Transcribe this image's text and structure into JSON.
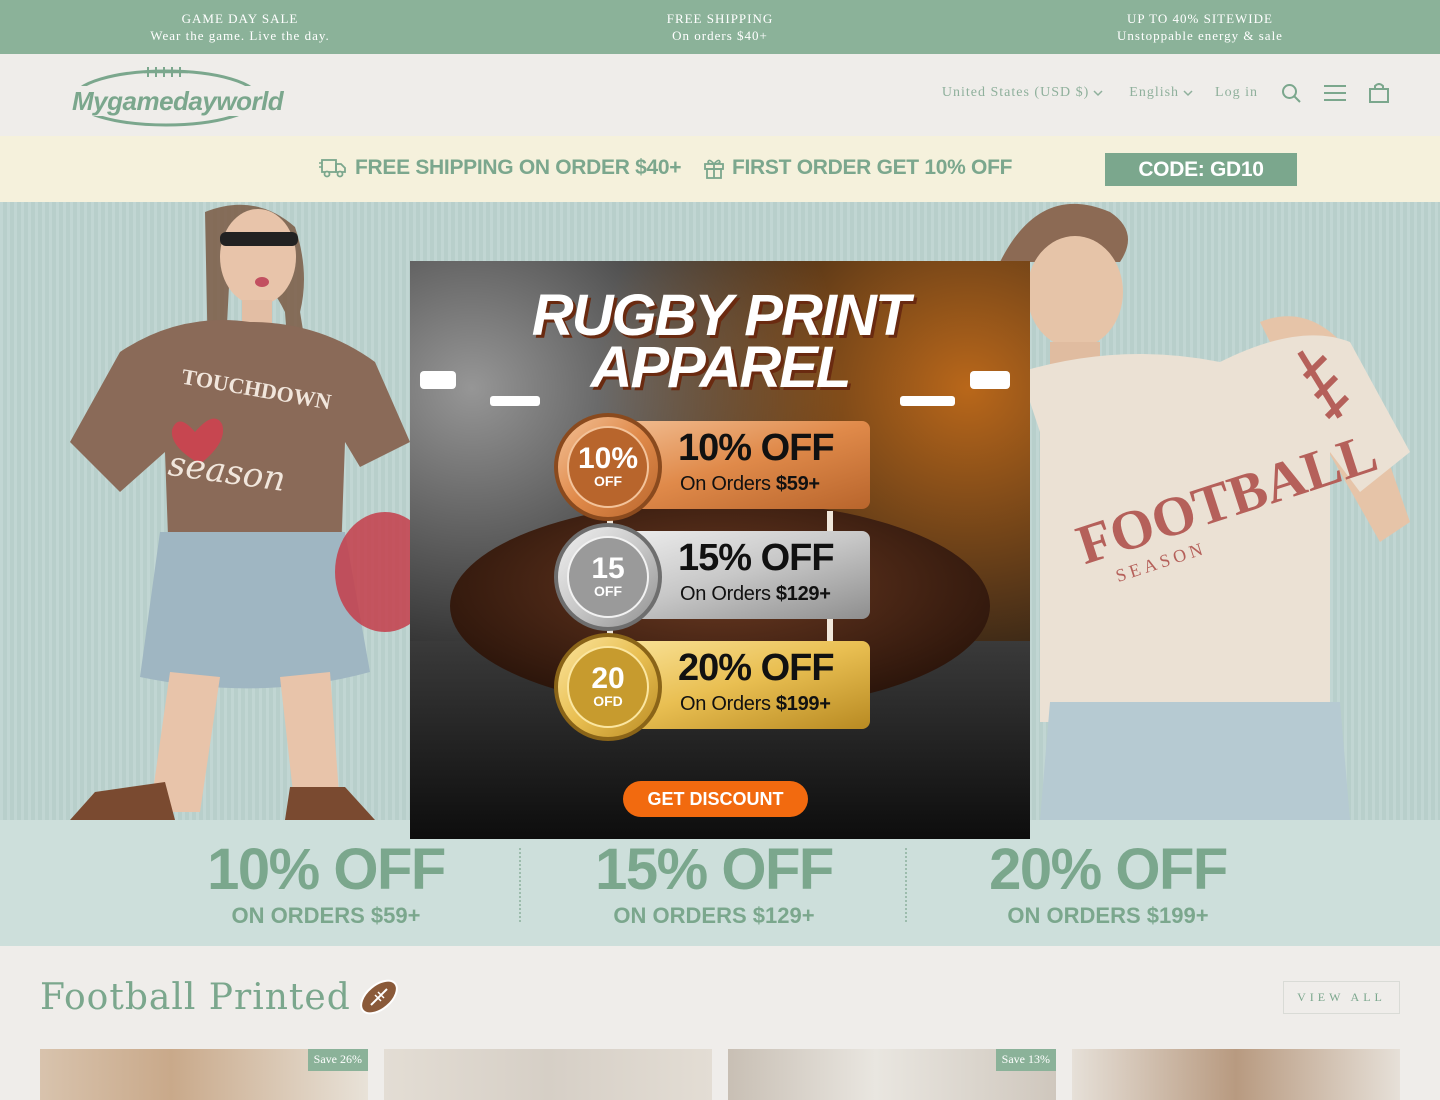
{
  "announcement": [
    {
      "title": "GAME DAY SALE",
      "subtitle": "Wear the game. Live the day."
    },
    {
      "title": "FREE SHIPPING",
      "subtitle": "On orders $40+"
    },
    {
      "title": "UP TO 40% SITEWIDE",
      "subtitle": "Unstoppable energy & sale"
    }
  ],
  "header": {
    "logo_text": "Mygamedayworld",
    "country": "United States (USD $)",
    "language": "English",
    "login": "Log in",
    "icons": [
      "search-icon",
      "menu-icon",
      "cart-icon"
    ]
  },
  "promo": {
    "shipping": "FREE SHIPPING ON ORDER $40+",
    "first_order": "FIRST ORDER GET 10% OFF",
    "code": "CODE: GD10"
  },
  "popup": {
    "title_line1": "RUGBY PRINT",
    "title_line2": "APPAREL",
    "tiers": [
      {
        "medal_num": "10%",
        "medal_label": "OFF",
        "off": "10% OFF",
        "cond_prefix": "On Orders ",
        "cond_amount": "$59+"
      },
      {
        "medal_num": "15",
        "medal_label": "OFF",
        "off": "15% OFF",
        "cond_prefix": "On Orders ",
        "cond_amount": "$129+"
      },
      {
        "medal_num": "20",
        "medal_label": "OFD",
        "off": "20% OFF",
        "cond_prefix": "On Orders ",
        "cond_amount": "$199+"
      }
    ],
    "button": "GET DISCOUNT"
  },
  "hero": {
    "left_shirt_text_1": "TOUCHDOWN",
    "left_shirt_text_2": "season",
    "right_shirt_text_1": "FOOTBALL",
    "right_shirt_text_2": "SEASON"
  },
  "discounts": [
    {
      "big": "10% OFF",
      "small": "ON ORDERS $59+"
    },
    {
      "big": "15% OFF",
      "small": "ON ORDERS $129+"
    },
    {
      "big": "20% OFF",
      "small": "ON ORDERS $199+"
    }
  ],
  "section": {
    "title": "Football Printed",
    "view_all": "VIEW ALL",
    "cards": [
      {
        "badge": "Save 26%"
      },
      {
        "badge": ""
      },
      {
        "badge": "Save 13%"
      },
      {
        "badge": ""
      }
    ]
  },
  "colors": {
    "brand": "#7ba78d",
    "announce_bg": "#8bb299",
    "promo_bg": "#f5f1dc",
    "hero_bg": "#bcd3cf",
    "discount_bg": "#cddfdb",
    "popup_button": "#f26a0f"
  }
}
